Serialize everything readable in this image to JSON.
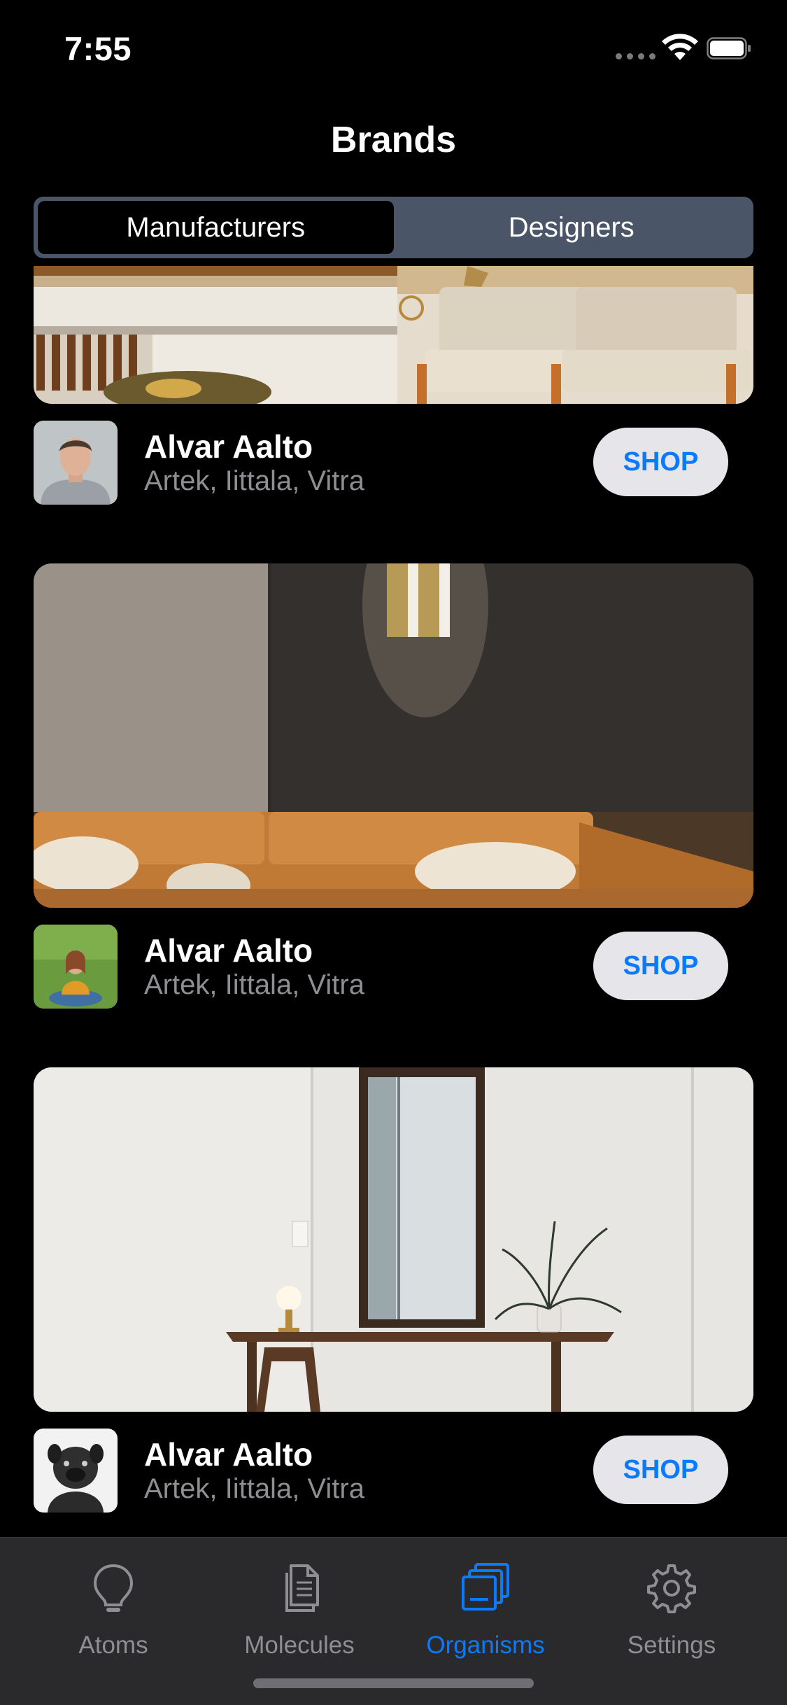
{
  "status_bar": {
    "time": "7:55"
  },
  "header": {
    "title": "Brands"
  },
  "segments": [
    {
      "label": "Manufacturers",
      "selected": true
    },
    {
      "label": "Designers",
      "selected": false
    }
  ],
  "cards": [
    {
      "name": "Alvar Aalto",
      "brands": "Artek, Iittala, Vitra",
      "button": "SHOP",
      "image": "lounge-chairs-photo",
      "avatar": "man-portrait"
    },
    {
      "name": "Alvar Aalto",
      "brands": "Artek, Iittala, Vitra",
      "button": "SHOP",
      "image": "leather-sofa-photo",
      "avatar": "woman-on-grass"
    },
    {
      "name": "Alvar Aalto",
      "brands": "Artek, Iittala, Vitra",
      "button": "SHOP",
      "image": "desk-mirror-photo",
      "avatar": "pug-dog"
    }
  ],
  "tab_bar": {
    "tabs": [
      {
        "label": "Atoms",
        "icon": "lightbulb-icon",
        "selected": false
      },
      {
        "label": "Molecules",
        "icon": "documents-icon",
        "selected": false
      },
      {
        "label": "Organisms",
        "icon": "stacked-squares-icon",
        "selected": true
      },
      {
        "label": "Settings",
        "icon": "gear-icon",
        "selected": false
      }
    ]
  },
  "colors": {
    "accent": "#0a7aff",
    "segment_bg": "#4a5568",
    "tab_bar_bg": "#2a2a2c",
    "secondary_text": "#8e8e93"
  }
}
